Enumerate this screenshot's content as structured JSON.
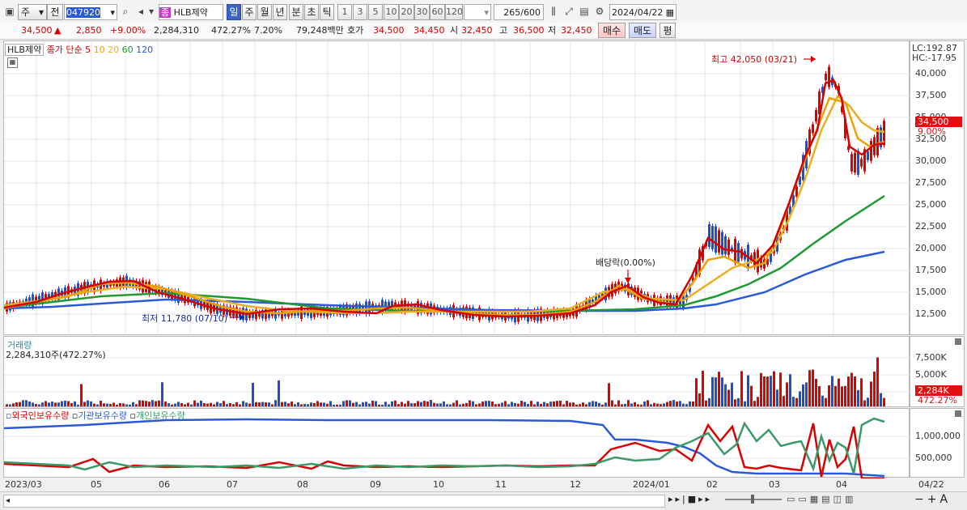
{
  "toolbar": {
    "market_label": "주",
    "prev_label": "전",
    "code_value": "047920",
    "type_badge": "종",
    "stock_name": "HLB제약",
    "period_day": "일",
    "period_week": "주",
    "period_month": "월",
    "period_year": "년",
    "period_min": "분",
    "period_sec": "초",
    "period_tick": "틱",
    "intervals": [
      "1",
      "3",
      "5",
      "10",
      "20",
      "30",
      "60",
      "120"
    ],
    "count_value": "265",
    "count_total": "/600",
    "date_value": "2024/04/22"
  },
  "quote": {
    "price": "34,500",
    "change_arrow": "▲",
    "change": "2,850",
    "change_pct": "+9.00%",
    "volume": "2,284,310",
    "volume_ratio": "472.27%",
    "turnover": "7.20%",
    "amount": "79,248백만",
    "bid_label": "호가",
    "bid1": "34,500",
    "bid2": "34,450",
    "open_label": "시",
    "open": "32,450",
    "high_label": "고",
    "high": "36,500",
    "low_label": "저",
    "low": "32,450",
    "buy_label": "매수",
    "sell_label": "매도",
    "eval_label": "평"
  },
  "price_pane": {
    "legend_name": "HLB제약",
    "legend_close": "종가 단순 5",
    "legend_ma": [
      "10",
      "20",
      "60",
      "120"
    ],
    "lc_label": "LC:192.87",
    "hc_label": "HC:-17.95",
    "high_annotation": "최고 42,050 (03/21)",
    "low_annotation": "최저 11,780 (07/10)",
    "dividend_annotation": "배당락(0.00%)",
    "price_tag": "34,500",
    "pct_tag": "9.00%",
    "y_ticks": [
      "40,000",
      "37,500",
      "35,000",
      "32,500",
      "30,000",
      "27,500",
      "25,000",
      "22,500",
      "20,000",
      "17,500",
      "15,000",
      "12,500"
    ]
  },
  "volume_pane": {
    "title": "거래량",
    "value_label": "2,284,310주(472.27%)",
    "y_ticks": [
      "7,500K",
      "5,000K"
    ],
    "tag_value": "2,284K",
    "tag_pct": "472.27%"
  },
  "holding_pane": {
    "legend_foreign": "외국인보유수량",
    "legend_inst": "기관보유수량",
    "legend_indiv": "개인보유수량",
    "y_ticks": [
      "1,000,000",
      "500,000"
    ]
  },
  "x_axis": [
    "2023/03",
    "05",
    "06",
    "07",
    "08",
    "09",
    "10",
    "11",
    "12",
    "2024/01",
    "02",
    "03",
    "04"
  ],
  "x_axis_end": "04/22",
  "colors": {
    "up": "#e00000",
    "down": "#1f4fd0",
    "ma5": "#d40000",
    "ma10": "#f0a000",
    "ma20": "#e8b020",
    "ma60": "#1e9a30",
    "ma120": "#2a5ad8",
    "foreign": "#2a5ad8",
    "inst": "#d80000",
    "indiv": "#3c9a6a"
  }
}
